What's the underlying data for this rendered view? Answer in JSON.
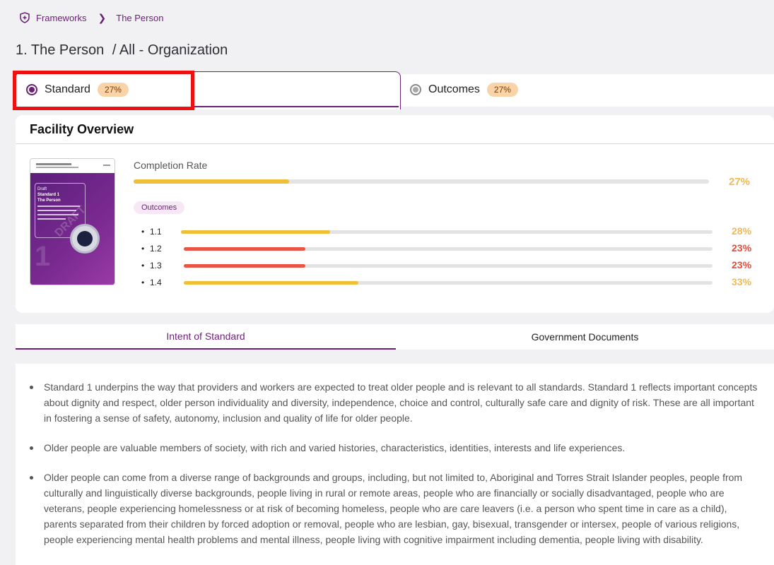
{
  "breadcrumb": {
    "items": [
      "Frameworks",
      "The Person"
    ],
    "icon": "shield-plus-icon",
    "separator_icon": "chevron-right-icon"
  },
  "page": {
    "title": "1. The Person",
    "subtitle": "/ All - Organization"
  },
  "tabs": [
    {
      "label": "Standard",
      "percent": "27%",
      "selected": true
    },
    {
      "label": "Outcomes",
      "percent": "27%",
      "selected": false
    }
  ],
  "facility": {
    "title": "Facility Overview",
    "completion_label": "Completion Rate",
    "completion_percent": "27%",
    "completion_value": 27,
    "outcomes_pill": "Outcomes",
    "outcomes": [
      {
        "label": "1.1",
        "percent": "28%",
        "value": 28,
        "status": "warning"
      },
      {
        "label": "1.2",
        "percent": "23%",
        "value": 23,
        "status": "danger"
      },
      {
        "label": "1.3",
        "percent": "23%",
        "value": 23,
        "status": "danger"
      },
      {
        "label": "1.4",
        "percent": "33%",
        "value": 33,
        "status": "warning"
      }
    ],
    "cover": {
      "heading": "Draft",
      "title_line1": "Standard 1",
      "title_line2": "The Person",
      "big_number": "1",
      "watermark": "DRAFT"
    }
  },
  "section_tabs": [
    "Intent of Standard",
    "Government Documents"
  ],
  "intent": [
    "Standard 1 underpins the way that providers and workers are expected to treat older people and is relevant to all standards. Standard 1 reflects important concepts about dignity and respect, older person individuality and diversity, independence, choice and control, culturally safe care and dignity of risk. These are all important in fostering a sense of safety, autonomy, inclusion and quality of life for older people.",
    "Older people are valuable members of society, with rich and varied histories, characteristics, identities, interests and life experiences.",
    "Older people can come from a diverse range of backgrounds and groups, including, but not limited to, Aboriginal and Torres Strait Islander peoples, people from culturally and linguistically diverse backgrounds, people living in rural or remote areas, people who are financially or socially disadvantaged, people who are veterans, people experiencing homelessness or at risk of becoming homeless, people who are care leavers (i.e. a person who spent time in care as a child), parents separated from their children by forced adoption or removal, people who are lesbian, gay, bisexual, transgender or intersex, people of various religions, people experiencing mental health problems and mental illness, people living with cognitive impairment including dementia, people living with disability."
  ],
  "colors": {
    "brand": "#6b1f77",
    "warning": "#f0bf38",
    "danger": "#e85544",
    "warning_text": "#f0b955",
    "danger_text": "#e84a3a",
    "highlight": "#ee1111"
  }
}
